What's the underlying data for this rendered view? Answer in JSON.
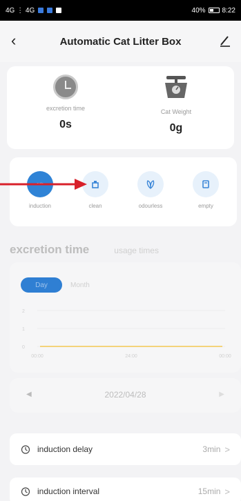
{
  "status_bar": {
    "left_text": "4G ⋮ 4G",
    "battery": "40%",
    "time": "8:22"
  },
  "nav": {
    "back_icon": "‹",
    "title": "Automatic Cat Litter Box",
    "edit_icon": "edit-icon"
  },
  "stats": {
    "excretion_label": "excretion time",
    "excretion_value": "0s",
    "weight_label": "Cat Weight",
    "weight_value": "0g"
  },
  "modes": [
    {
      "label": "induction",
      "icon": "auto",
      "active": true
    },
    {
      "label": "clean",
      "icon": "clean-icon",
      "active": false
    },
    {
      "label": "odourless",
      "icon": "leaf-icon",
      "active": false
    },
    {
      "label": "empty",
      "icon": "trash-icon",
      "active": false
    }
  ],
  "tabs": {
    "main": "excretion time",
    "sub": "usage times"
  },
  "chart": {
    "toggle_day": "Day",
    "toggle_month": "Month"
  },
  "chart_data": {
    "type": "line",
    "x_ticks": [
      "00:00",
      "24:00",
      "00:00"
    ],
    "y_ticks": [
      "2",
      "1",
      "0"
    ],
    "series": [
      {
        "values": [
          0,
          0,
          0,
          0,
          0,
          0,
          0
        ]
      }
    ],
    "ylim": [
      0,
      2
    ],
    "line_color": "#f4d37a"
  },
  "date": {
    "prev": "◀",
    "value": "2022/04/28",
    "next": "▶"
  },
  "settings": [
    {
      "label": "induction delay",
      "value": "3min",
      "chevron": ">"
    },
    {
      "label": "induction interval",
      "value": "15min",
      "chevron": ">"
    }
  ],
  "colors": {
    "accent": "#2f83d6",
    "annotation_arrow": "#d8202a"
  }
}
